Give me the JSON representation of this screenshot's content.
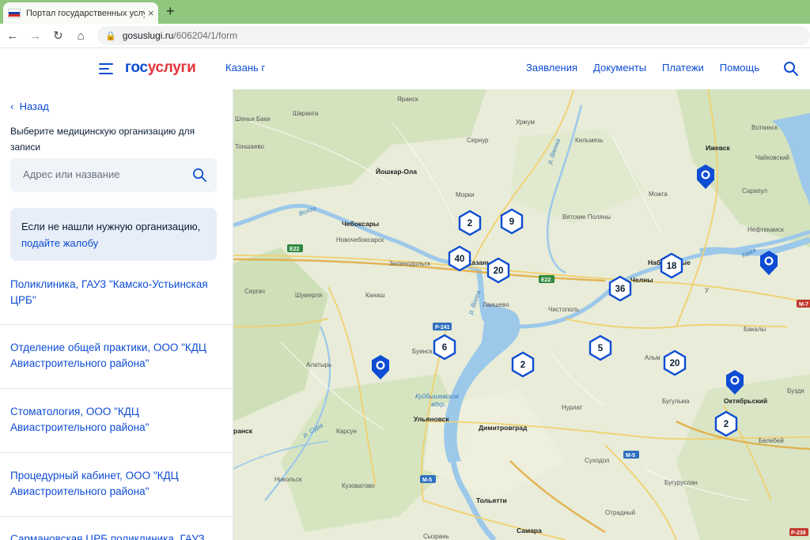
{
  "browser": {
    "tab_title": "Портал государственных услуг Р",
    "tab_close": "×",
    "new_tab": "+",
    "url_host": "gosuslugi.ru",
    "url_path": "/606204/1/form"
  },
  "header": {
    "logo_part1": "гос",
    "logo_part2": "услуги",
    "city": "Казань г",
    "nav": [
      "Заявления",
      "Документы",
      "Платежи",
      "Помощь"
    ]
  },
  "panel": {
    "back": "Назад",
    "prompt": "Выберите медицинскую организацию для записи",
    "search_placeholder": "Адрес или название",
    "notice_text": "Если не нашли нужную организацию,",
    "notice_link": "подайте жалобу",
    "orgs": [
      "Поликлиника, ГАУЗ \"Камско-Устьинская ЦРБ\"",
      "Отделение общей практики, ООО \"КДЦ Авиастроительного района\"",
      "Стоматология, ООО \"КДЦ Авиастроительного района\"",
      "Процедурный кабинет, ООО \"КДЦ Авиастроительного района\"",
      "Сармановская ЦРБ поликлиника, ГАУЗ"
    ]
  },
  "map": {
    "clusters": [
      "2",
      "9",
      "40",
      "20",
      "36",
      "18",
      "6",
      "2",
      "5",
      "20",
      "2"
    ],
    "places": {
      "yaransk": "Яранск",
      "sharanga": "Шаранга",
      "tonshaevo": "Тоншаево",
      "urzhum": "Уржум",
      "sernur": "Сернур",
      "kilmez": "Кильмезь",
      "izhevsk": "Ижевск",
      "votkinsk": "Воткинск",
      "chaykovsky": "Чайковский",
      "ioshkar": "Йошкар-Ола",
      "morki": "Морки",
      "mozhga": "Можга",
      "sarapul": "Сарапул",
      "vyatskie": "Вятские Поляны",
      "cheboksary": "Чебоксары",
      "novocheb": "Новочебоксарск",
      "neftekamsk": "Нефтекамск",
      "zelenodolsk": "Зеленодольск",
      "kazan": "Казань",
      "naberezhnye": "Набережные",
      "chelny": "Челны",
      "sergach": "Сергач",
      "shumerlya": "Шумерля",
      "kanash": "Канаш",
      "laishevo": "Лаишево",
      "chistopol": "Чистополь",
      "bakaly": "Бакалы",
      "alatyr": "Алатырь",
      "buinsk": "Буинск",
      "almetyevsk": "Альм",
      "oktyabrsky": "Октябрьский",
      "bugulma": "Бугульма",
      "buzdyak": "Буздя",
      "ulyanovsk": "Ульяновск",
      "nurlat": "Нурлат",
      "dimitrovgrad": "Димитровград",
      "saransk": "ранск",
      "karsun": "Карсун",
      "belebey": "Белебей",
      "sukhodol": "Суходол",
      "nikolsk": "Никольск",
      "kuzovatovo": "Кузоватово",
      "buguruslan": "Бугуруслан",
      "tolyatti": "Тольятти",
      "samara": "Самара",
      "syzran": "Сызрань",
      "otradny": "Отрадный",
      "kuibyshev_res": "Куйбышевское",
      "kuibyshev_res2": "вдхр.",
      "volga1": "Волга",
      "volga2": "р. Волга",
      "kama": "Кама",
      "sura": "р. Сура",
      "vyatka": "р. Вятка",
      "shaki": "Шеньи Баки",
      "ural": "У"
    },
    "roads": [
      "E22",
      "E22",
      "P-241",
      "M-5",
      "M-5",
      "M-7",
      "P-239"
    ]
  }
}
